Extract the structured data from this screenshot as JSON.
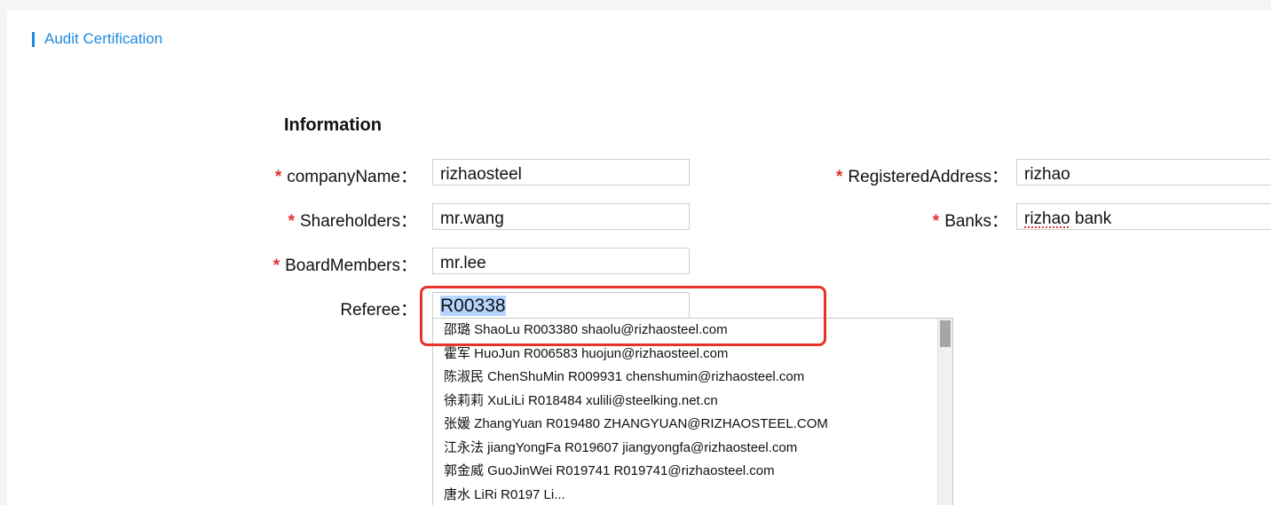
{
  "section": {
    "title": "Audit Certification"
  },
  "form": {
    "heading": "Information",
    "required_mark": "*",
    "company_name": {
      "label": "companyName：",
      "value": "rizhaosteel"
    },
    "registered_address": {
      "label": "RegisteredAddress：",
      "value": "rizhao"
    },
    "shareholders": {
      "label": "Shareholders：",
      "value": "mr.wang"
    },
    "banks": {
      "label": "Banks：",
      "value_part1": "rizhao",
      "value_part2": " bank"
    },
    "board_members": {
      "label": "BoardMembers：",
      "value": "mr.lee"
    },
    "referee": {
      "label": "Referee：",
      "value": "R00338"
    }
  },
  "referee_dropdown": {
    "options": [
      "邵璐 ShaoLu R003380 shaolu@rizhaosteel.com",
      "霍军 HuoJun R006583 huojun@rizhaosteel.com",
      "陈淑民 ChenShuMin R009931 chenshumin@rizhaosteel.com",
      "徐莉莉 XuLiLi R018484 xulili@steelking.net.cn",
      "张媛 ZhangYuan R019480 ZHANGYUAN@RIZHAOSTEEL.COM",
      "江永法 jiangYongFa R019607 jiangyongfa@rizhaosteel.com",
      "郭金威 GuoJinWei R019741 R019741@rizhaosteel.com",
      "唐水 LiRi R0197 Li..."
    ]
  },
  "colors": {
    "accent": "#1f8ae0",
    "required": "#e0322f",
    "annotation": "#e8332a"
  }
}
